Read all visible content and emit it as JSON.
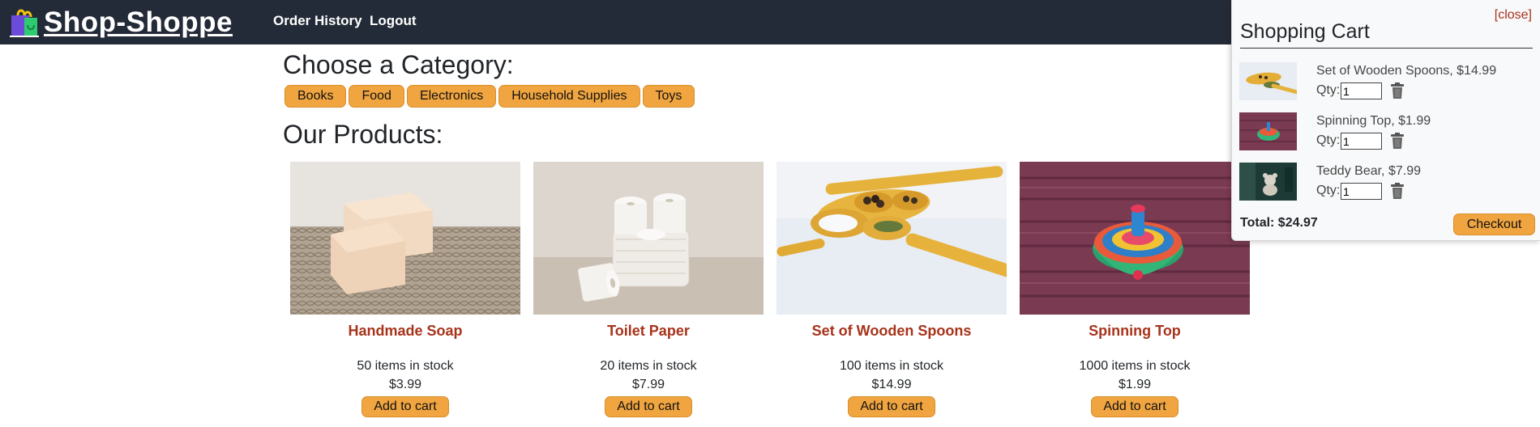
{
  "nav": {
    "brand": "Shop-Shoppe",
    "links": [
      "Order History",
      "Logout"
    ]
  },
  "main": {
    "category_heading": "Choose a Category:",
    "categories": [
      "Books",
      "Food",
      "Electronics",
      "Household Supplies",
      "Toys"
    ],
    "products_heading": "Our Products:",
    "products": [
      {
        "name": "Handmade Soap",
        "stock": "50 items in stock",
        "price": "$3.99",
        "button": "Add to cart"
      },
      {
        "name": "Toilet Paper",
        "stock": "20 items in stock",
        "price": "$7.99",
        "button": "Add to cart"
      },
      {
        "name": "Set of Wooden Spoons",
        "stock": "100 items in stock",
        "price": "$14.99",
        "button": "Add to cart"
      },
      {
        "name": "Spinning Top",
        "stock": "1000 items in stock",
        "price": "$1.99",
        "button": "Add to cart"
      }
    ]
  },
  "cart": {
    "close_label": "[close]",
    "title": "Shopping Cart",
    "qty_label": "Qty:",
    "items": [
      {
        "label": "Set of Wooden Spoons, $14.99",
        "qty": "1"
      },
      {
        "label": "Spinning Top, $1.99",
        "qty": "1"
      },
      {
        "label": "Teddy Bear, $7.99",
        "qty": "1"
      }
    ],
    "total": "Total: $24.97",
    "checkout_label": "Checkout"
  },
  "colors": {
    "navbar_bg": "#242b38",
    "accent_button": "#f0a540",
    "product_link": "#a8331b"
  }
}
